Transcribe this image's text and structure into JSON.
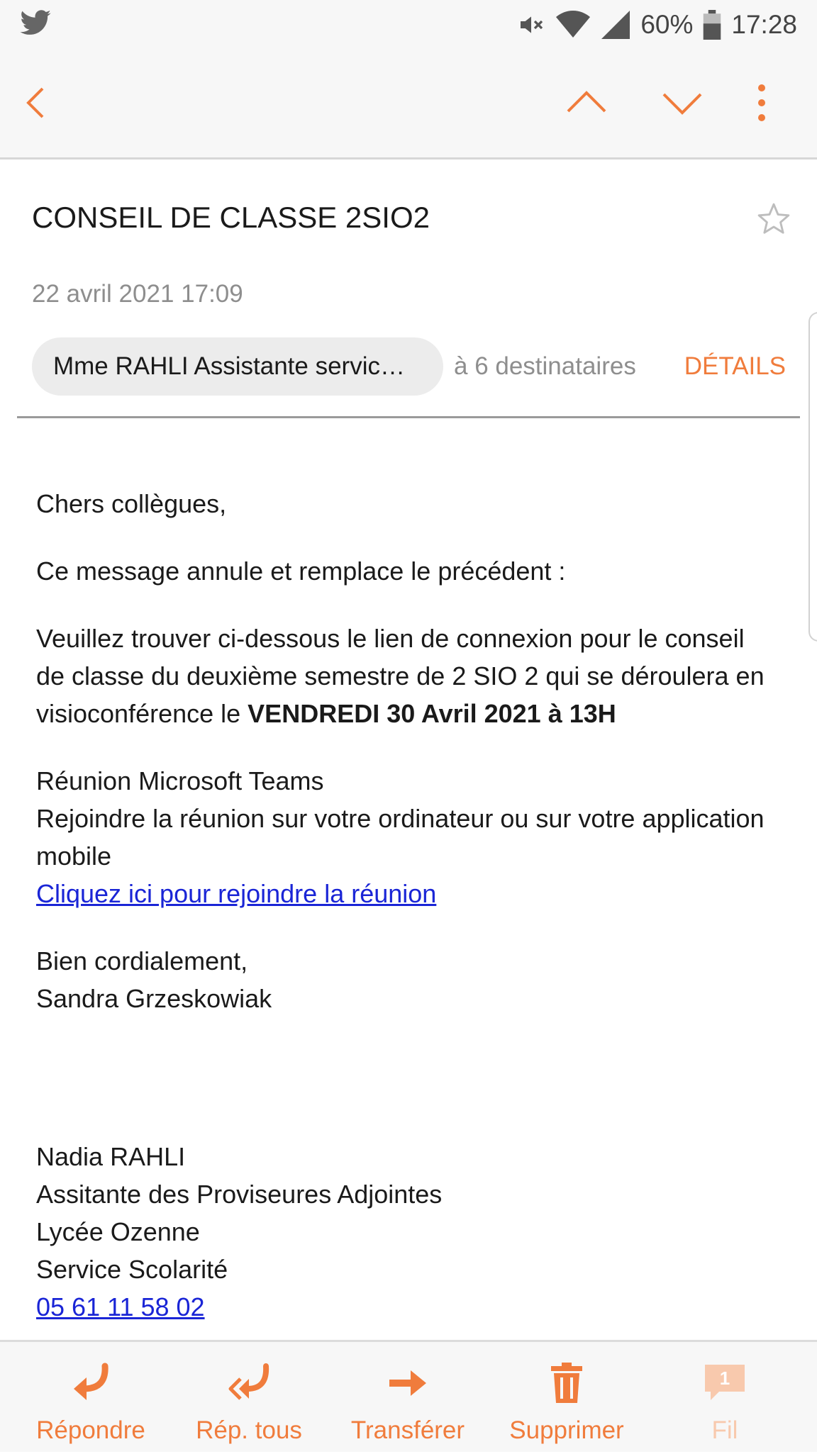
{
  "status": {
    "battery": "60%",
    "time": "17:28"
  },
  "email": {
    "subject": "CONSEIL DE CLASSE 2SIO2",
    "date": "22 avril 2021  17:09",
    "sender": "Mme RAHLI Assistante servic…",
    "recipients": "à 6 destinataires",
    "details_label": "DÉTAILS"
  },
  "body": {
    "greeting": "Chers collègues,",
    "line1": "Ce message annule et remplace le précédent :",
    "para_a": "Veuillez trouver ci-dessous le lien de connexion pour le conseil de classe du deuxième semestre de 2 SIO 2 qui se déroulera en visioconférence le ",
    "para_bold": "VENDREDI 30 Avril 2021 à 13H",
    "teams_title": "Réunion Microsoft Teams",
    "teams_desc": "Rejoindre la réunion sur votre ordinateur ou sur votre application mobile",
    "teams_link": "Cliquez ici pour rejoindre la réunion",
    "closing": "Bien cordialement,",
    "signer": "Sandra Grzeskowiak",
    "sig_name": "Nadia RAHLI",
    "sig_role": "Assitante des Proviseures Adjointes",
    "sig_school": "Lycée Ozenne",
    "sig_service": "Service Scolarité",
    "sig_phone": "05 61 11 58 02"
  },
  "actions": {
    "reply": "Répondre",
    "reply_all": "Rép. tous",
    "forward": "Transférer",
    "delete": "Supprimer",
    "thread": "Fil",
    "thread_count": "1"
  },
  "colors": {
    "accent": "#f07c3c",
    "link": "#1a25d6"
  }
}
